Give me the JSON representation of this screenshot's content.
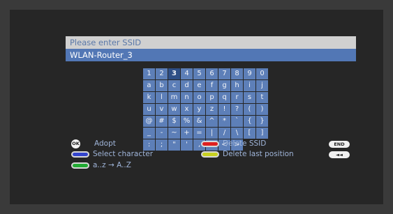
{
  "dialog": {
    "prompt": "Please enter SSID",
    "ssid_value": "WLAN-Router_3"
  },
  "keyboard": {
    "selected": "3",
    "keys": [
      "1",
      "2",
      "3",
      "4",
      "5",
      "6",
      "7",
      "8",
      "9",
      "0",
      "a",
      "b",
      "c",
      "d",
      "e",
      "f",
      "g",
      "h",
      "i",
      "j",
      "k",
      "l",
      "m",
      "n",
      "o",
      "p",
      "q",
      "r",
      "s",
      "t",
      "u",
      "v",
      "w",
      "x",
      "y",
      "z",
      "!",
      "?",
      "(",
      ")",
      "@",
      "#",
      "$",
      "%",
      "&",
      "^",
      "*",
      "`",
      "{",
      "}",
      "_",
      "-",
      "~",
      "+",
      "=",
      "|",
      "/",
      "\\",
      "[",
      "]",
      ":",
      ";",
      "\"",
      "'",
      ",",
      ".",
      "<",
      ">"
    ]
  },
  "legend": {
    "ok_label": "Adopt",
    "ok_icon_text": "OK",
    "blue_label": "Select character",
    "green_label": "a..z → A..Z",
    "red_label": "Delete SSID",
    "yellow_label": "Delete last position",
    "end_badge": "END",
    "back_badge": "◄◄"
  },
  "colors": {
    "key_bg": "#5d7fb8",
    "ssid_bg": "#5277b5",
    "legend_text": "#9fb4d8"
  }
}
